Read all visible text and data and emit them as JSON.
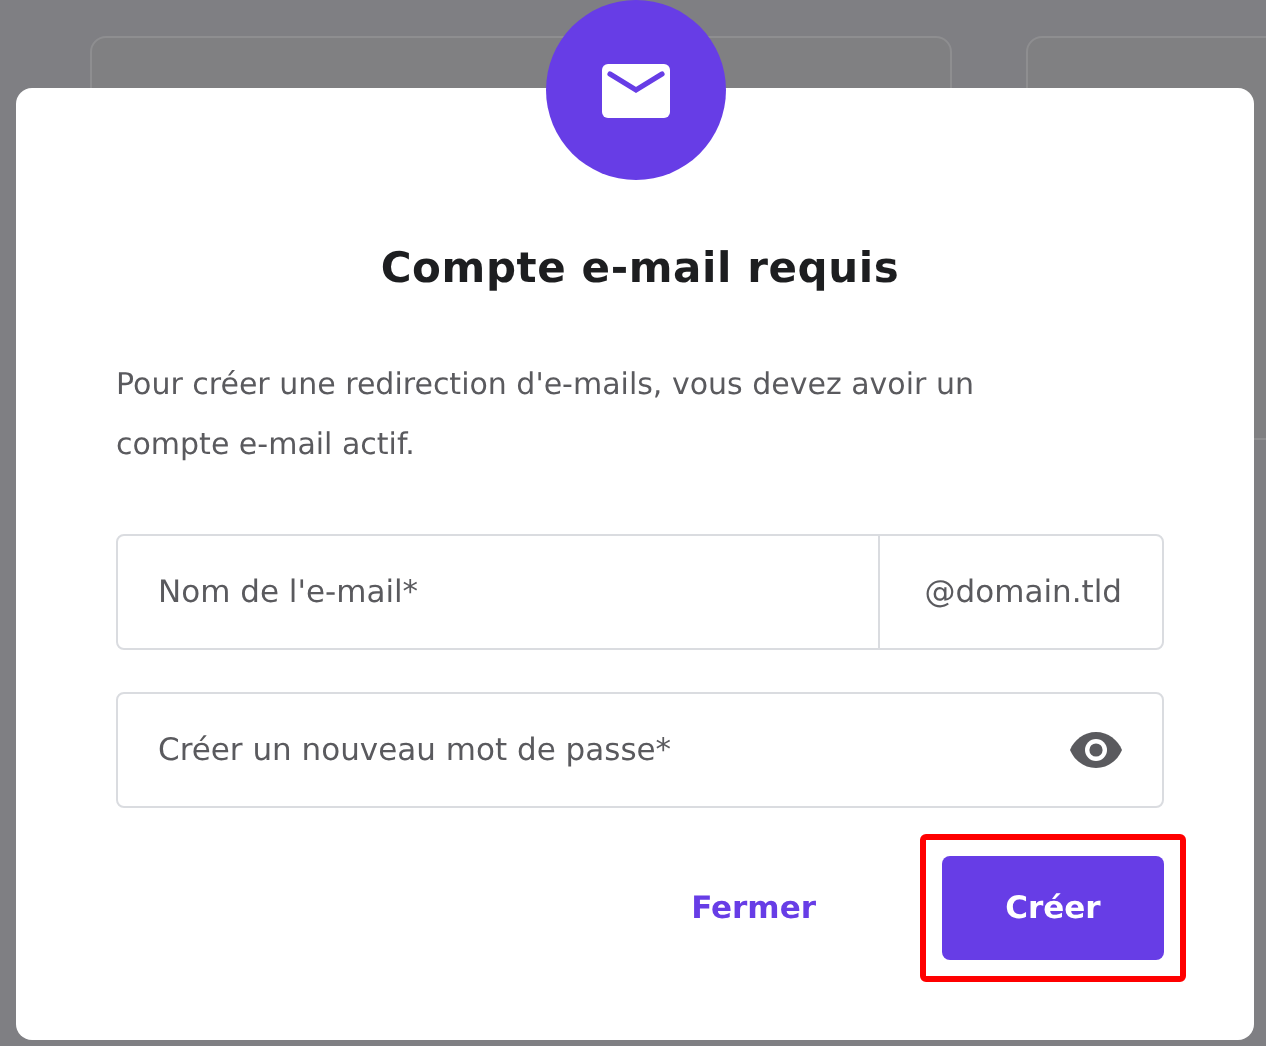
{
  "dialog": {
    "title": "Compte e-mail requis",
    "message": "Pour créer une redirection d'e-mails, vous devez avoir un compte e-mail actif.",
    "email_field": {
      "placeholder": "Nom de l'e-mail*",
      "suffix": "@domain.tld"
    },
    "password_field": {
      "placeholder": "Créer un nouveau mot de passe*"
    },
    "buttons": [
      {
        "label": "Fermer",
        "kind": "secondary",
        "highlighted": false
      },
      {
        "label": "Créer",
        "kind": "primary",
        "highlighted": true
      }
    ]
  }
}
